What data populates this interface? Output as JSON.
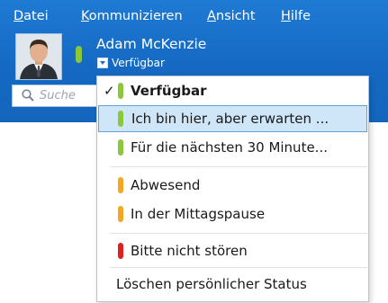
{
  "menubar": {
    "items": [
      {
        "underline": "D",
        "rest": "atei"
      },
      {
        "underline": "K",
        "rest": "ommunizieren"
      },
      {
        "underline": "A",
        "rest": "nsicht"
      },
      {
        "underline": "H",
        "rest": "ilfe"
      }
    ]
  },
  "user": {
    "name": "Adam McKenzie",
    "status": "Verfügbar"
  },
  "search": {
    "placeholder": "Suche"
  },
  "status_menu": {
    "items": [
      {
        "label": "Verfügbar",
        "status": "available",
        "checked": true
      },
      {
        "label": "Ich bin hier, aber erwarten ...",
        "status": "available",
        "highlighted": true
      },
      {
        "label": "Für die nächsten 30 Minute...",
        "status": "available"
      },
      {
        "label": "Abwesend",
        "status": "away"
      },
      {
        "label": "In der Mittagspause",
        "status": "away"
      },
      {
        "label": "Bitte nicht stören",
        "status": "busy"
      },
      {
        "label": "Löschen persönlicher Status",
        "status": "none"
      }
    ],
    "check_mark": "✓"
  },
  "colors": {
    "header_blue": "#1569c2",
    "available": "#8ac73a",
    "away": "#f5a623",
    "busy": "#e02020",
    "highlight": "#cfe6f8"
  }
}
